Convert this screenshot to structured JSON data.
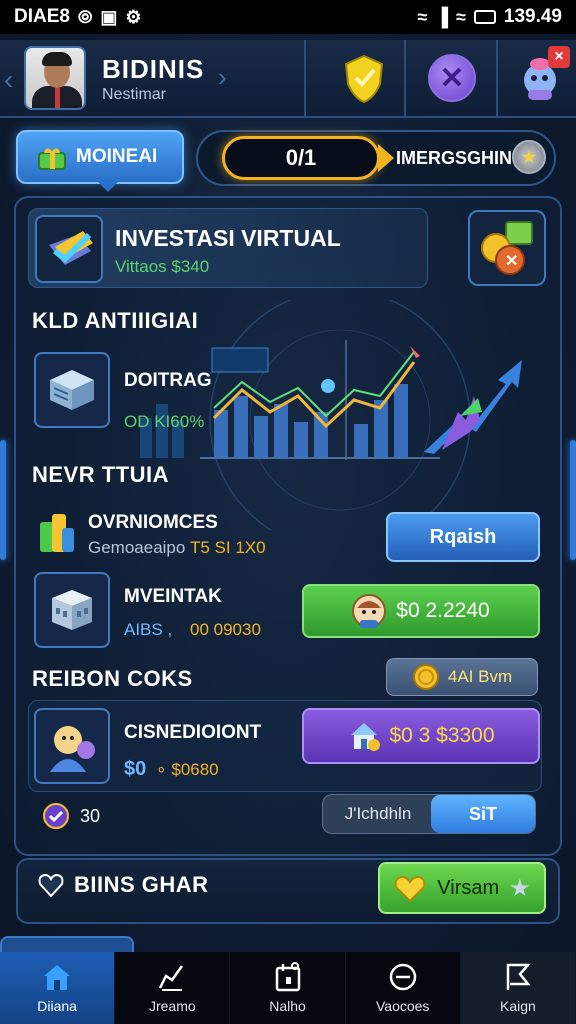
{
  "status_bar": {
    "carrier": "DIAE8",
    "time": "139.49"
  },
  "header": {
    "title": "BIDINIS",
    "subtitle": "Nestimar",
    "badge": "×"
  },
  "tab_button": {
    "label": "MOINEAI"
  },
  "progress": {
    "value_label": "0/1",
    "label": "IMERGSGHIN"
  },
  "investment": {
    "title": "INVESTASI VIRTUAL",
    "subtitle": "Vittaos $340"
  },
  "sections": {
    "first": "KLD ANTIIIGIAI",
    "second": "NEVR TTUIA",
    "third": "REIBON COKS"
  },
  "items": {
    "item1": {
      "title": "DOITRAG",
      "value": "OD KI60%"
    },
    "item2": {
      "title": "OVRNIOMCES",
      "sub_a": "Gemoaeaipo",
      "sub_b": "T5 SI 1X0"
    },
    "item3": {
      "title": "MVEINTAK",
      "sub_a": "AIBS ,",
      "sub_b": "00 09030"
    },
    "item4": {
      "title": "CISNEDIOIONT",
      "sub_a": "$0",
      "sub_b": "∘ $0680"
    }
  },
  "buttons": {
    "blue": "Rqaish",
    "green": "$0 2.2240",
    "gray": "4AI Bvm",
    "purple": "$0 3 $3300",
    "green2": "Virsam"
  },
  "counter": {
    "value": "30"
  },
  "toggle": {
    "left": "J'Ichdhln",
    "right": "SiT"
  },
  "bottom_label": "BIINS GHAR",
  "nav": [
    {
      "label": "Diiana",
      "icon": "home-icon"
    },
    {
      "label": "Jreamo",
      "icon": "chart-icon"
    },
    {
      "label": "Nalho",
      "icon": "calendar-icon"
    },
    {
      "label": "Vaocoes",
      "icon": "clock-icon"
    },
    {
      "label": "Kaign",
      "icon": "flag-icon"
    }
  ],
  "colors": {
    "accent_blue": "#2f7ad8",
    "accent_gold": "#f3b320",
    "accent_green": "#5ccf4e",
    "accent_purple": "#8a5be0"
  }
}
